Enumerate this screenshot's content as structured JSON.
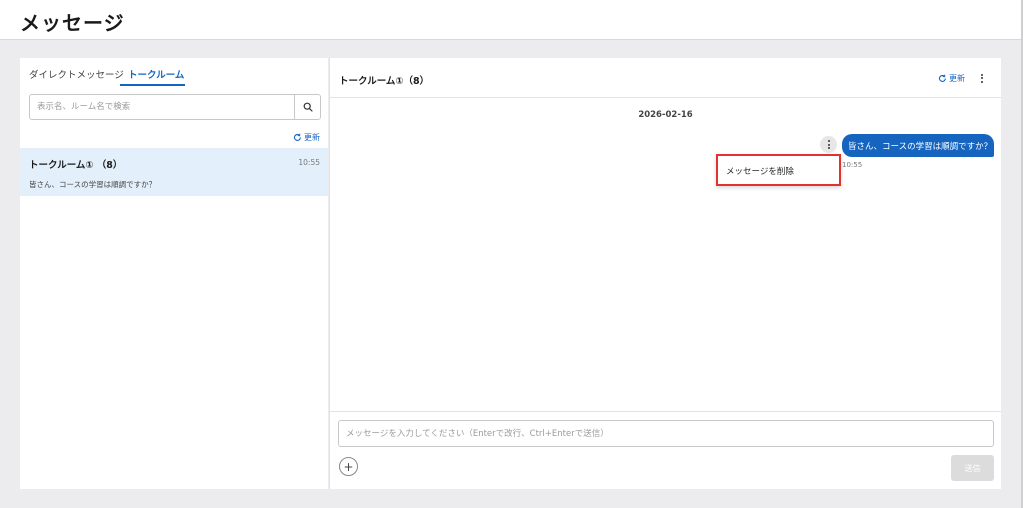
{
  "header": {
    "title": "メッセージ"
  },
  "sidebar": {
    "tabs": [
      {
        "label": "ダイレクトメッセージ",
        "active": false
      },
      {
        "label": "トークルーム",
        "active": true
      }
    ],
    "search": {
      "placeholder": "表示名、ルーム名で検索",
      "icon": "search-icon"
    },
    "refresh_label": "更新",
    "rooms": [
      {
        "name": "トークルーム① （8）",
        "time": "10:55",
        "preview": "皆さん、コースの学習は順調ですか？",
        "selected": true
      }
    ]
  },
  "chat": {
    "title": "トークルーム①（8）",
    "refresh_label": "更新",
    "date": "2026-02-16",
    "messages": [
      {
        "text": "皆さん、コースの学習は順調ですか？",
        "time": "10:55",
        "own": true
      }
    ],
    "context_menu": {
      "items": [
        "メッセージを削除"
      ]
    },
    "composer": {
      "placeholder": "メッセージを入力してください（Enterで改行、Ctrl+Enterで送信）",
      "attach_icon": "+",
      "send_label": "送信"
    }
  },
  "colors": {
    "accent": "#1565c0",
    "selected_room_bg": "#e3f0fb",
    "highlight_border": "#e0322f",
    "send_disabled": "#dcdcdc"
  }
}
